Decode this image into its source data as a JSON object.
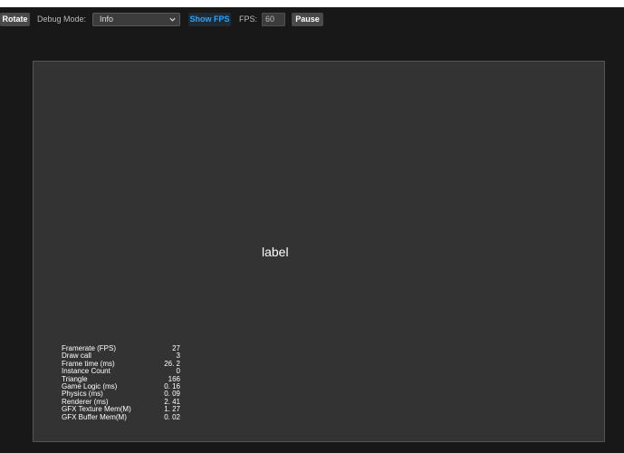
{
  "toolbar": {
    "rotate_label": "Rotate",
    "debug_mode_label": "Debug Mode:",
    "debug_mode_value": "Info",
    "show_fps_label": "Show FPS",
    "fps_label": "FPS:",
    "fps_value": "60",
    "pause_label": "Pause"
  },
  "canvas": {
    "center_label": "label",
    "stats": [
      {
        "name": "Framerate (FPS)",
        "value": "27"
      },
      {
        "name": "Draw call",
        "value": "3"
      },
      {
        "name": "Frame time (ms)",
        "value": "26. 2"
      },
      {
        "name": "Instance Count",
        "value": "0"
      },
      {
        "name": "Triangle",
        "value": "166"
      },
      {
        "name": "Game Logic (ms)",
        "value": "0. 16"
      },
      {
        "name": "Physics (ms)",
        "value": "0. 09"
      },
      {
        "name": "Renderer (ms)",
        "value": "2. 41"
      },
      {
        "name": "GFX Texture Mem(M)",
        "value": "1. 27"
      },
      {
        "name": "GFX Buffer Mem(M)",
        "value": "0. 02"
      }
    ]
  },
  "colors": {
    "background": "#181818",
    "canvas": "#333333",
    "accent": "#2aa4ff",
    "button": "#4a4a4a"
  },
  "icons": {
    "select_arrow": "chevron-down-icon"
  }
}
